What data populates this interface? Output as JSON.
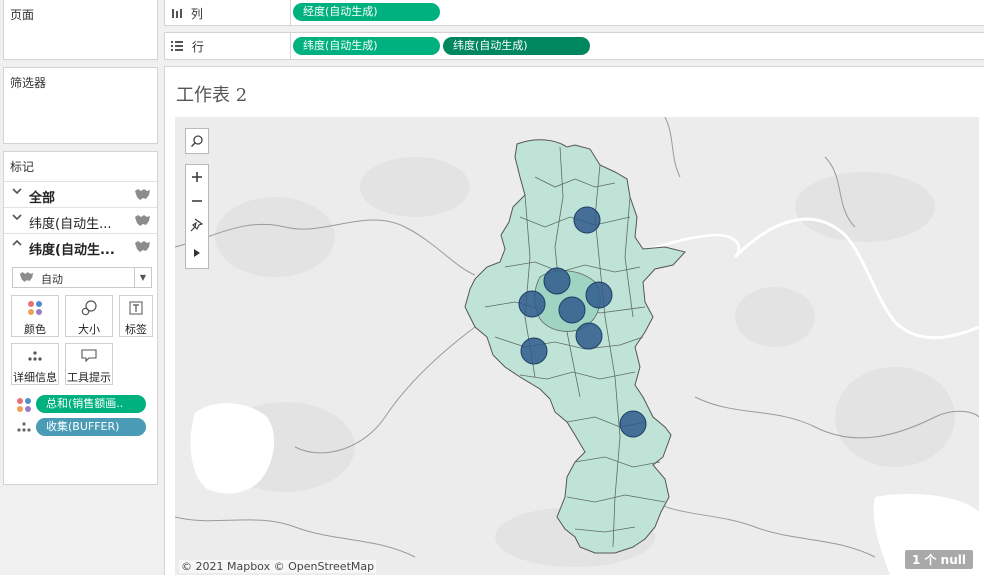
{
  "panels": {
    "pages_title": "页面",
    "filters_title": "筛选器",
    "marks_title": "标记"
  },
  "marks": {
    "layers": [
      {
        "label": "全部",
        "expanded": false
      },
      {
        "label": "纬度(自动生...",
        "expanded": false
      },
      {
        "label": "纬度(自动生...",
        "expanded": true
      }
    ],
    "mark_type": "自动",
    "buttons": {
      "color": "颜色",
      "size": "大小",
      "label": "标签",
      "detail": "详细信息",
      "tooltip": "工具提示"
    },
    "fields": [
      {
        "label": "总和(销售额画..",
        "color": "#00b180",
        "icon": "color-dots-icon"
      },
      {
        "label": "收集(BUFFER)",
        "color": "#4a9bb5",
        "icon": "detail-dots-icon"
      }
    ]
  },
  "shelves": {
    "columns_label": "列",
    "rows_label": "行",
    "columns_pills": [
      {
        "label": "经度(自动生成)",
        "color": "#00b180"
      }
    ],
    "rows_pills": [
      {
        "label": "纬度(自动生成)",
        "color": "#00b180"
      },
      {
        "label": "纬度(自动生成)",
        "color": "#00875f"
      }
    ]
  },
  "worksheet": {
    "title": "工作表 2",
    "attribution": "© 2021 Mapbox © OpenStreetMap",
    "null_indicator": "1 个 null",
    "region_fill": "#bfe3d6",
    "circle_fill": "#2f5a8c"
  }
}
